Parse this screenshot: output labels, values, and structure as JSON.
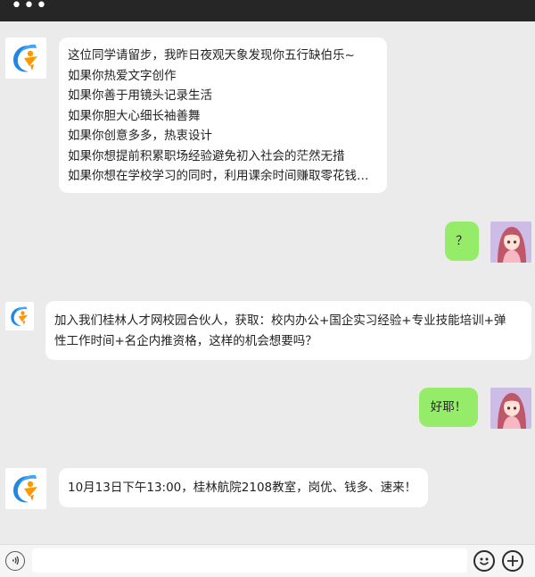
{
  "app": {
    "menu_icon": "more-dots-icon",
    "menu_glyph": "•••"
  },
  "messages": [
    {
      "side": "left",
      "lines": [
        "这位同学请留步，我昨日夜观天象发现你五行缺伯乐~",
        "如果你热爱文字创作",
        "如果你善于用镜头记录生活",
        "如果你胆大心细长袖善舞",
        "如果你创意多多，热衷设计",
        "如果你想提前积累职场经验避免初入社会的茫然无措",
        "如果你想在学校学习的同时，利用课余时间赚取零花钱…"
      ]
    },
    {
      "side": "right",
      "lines": [
        "？"
      ]
    },
    {
      "side": "left",
      "lines": [
        "加入我们桂林人才网校园合伙人，获取：校内办公+国企实习经验+专业技能培训+弹",
        "性工作时间+名企内推资格，这样的机会想要吗？"
      ]
    },
    {
      "side": "right",
      "lines": [
        "好耶！"
      ]
    },
    {
      "side": "left",
      "lines": [
        "10月13日下午13:00，桂林航院2108教室，岗优、钱多、速来！"
      ]
    }
  ],
  "bottom": {
    "voice_icon": "voice-icon",
    "emoji_icon": "emoji-icon",
    "plus_icon": "plus-icon"
  },
  "colors": {
    "background": "#ebebeb",
    "topbar": "#262626",
    "bubble_left": "#ffffff",
    "bubble_right": "#95ec69"
  }
}
